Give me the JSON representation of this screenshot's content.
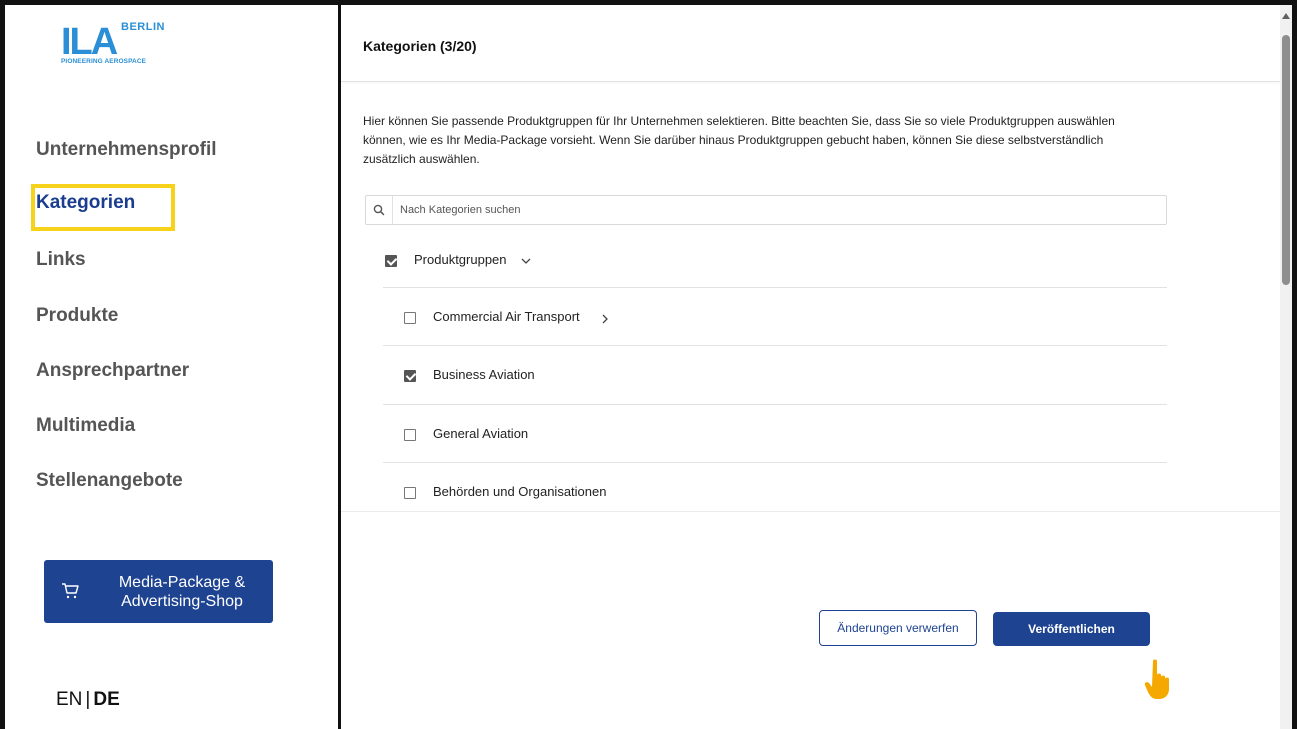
{
  "logo": {
    "brand": "ILA",
    "city": "BERLIN",
    "tagline": "PIONEERING AEROSPACE"
  },
  "sidebar": {
    "items": [
      {
        "label": "Unternehmensprofil",
        "active": false
      },
      {
        "label": "Kategorien",
        "active": true
      },
      {
        "label": "Links",
        "active": false
      },
      {
        "label": "Produkte",
        "active": false
      },
      {
        "label": "Ansprechpartner",
        "active": false
      },
      {
        "label": "Multimedia",
        "active": false
      },
      {
        "label": "Stellenangebote",
        "active": false
      }
    ],
    "shop_button": {
      "line1": "Media-Package &",
      "line2": "Advertising-Shop",
      "icon": "shopping-cart-icon"
    },
    "language": {
      "en": "EN",
      "separator": "|",
      "de": "DE",
      "selected": "DE"
    }
  },
  "main": {
    "header_title": "Kategorien (3/20)",
    "intro_text": "Hier können Sie passende Produktgruppen für Ihr Unternehmen selektieren. Bitte beachten Sie, dass Sie so viele Produktgruppen auswählen können, wie es Ihr Media-Package vorsieht. Wenn Sie darüber hinaus Produktgruppen gebucht haben, können Sie diese selbstverständlich zusätzlich auswählen.",
    "search": {
      "placeholder": "Nach Kategorien suchen",
      "value": "",
      "icon": "search-icon"
    },
    "group": {
      "label": "Produktgruppen",
      "checked": true,
      "expanded": true
    },
    "categories": [
      {
        "label": "Commercial Air Transport",
        "checked": false,
        "has_children": true
      },
      {
        "label": "Business Aviation",
        "checked": true,
        "has_children": false
      },
      {
        "label": "General Aviation",
        "checked": false,
        "has_children": false
      },
      {
        "label": "Behörden und Organisationen",
        "checked": false,
        "has_children": false
      }
    ],
    "buttons": {
      "discard": "Änderungen verwerfen",
      "publish": "Veröffentlichen"
    }
  },
  "colors": {
    "primary": "#1e4391",
    "logo_blue": "#2a8fd6",
    "highlight": "#f7d21a",
    "pointer": "#f5a800"
  }
}
